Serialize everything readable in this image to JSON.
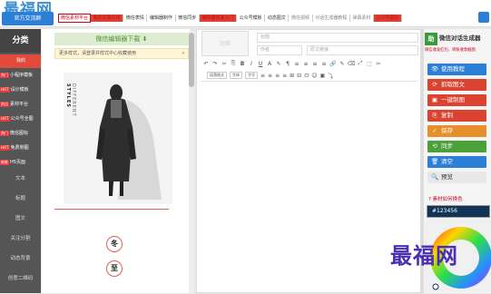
{
  "topbar": {
    "logo_text": "最福网",
    "logo_url": "WWW.ZUIFU.COM",
    "qq_button": "官方交流群",
    "nav": [
      {
        "label": "微信素材平台",
        "style": "redbox"
      },
      {
        "label": "我的文章在线",
        "style": "red"
      },
      {
        "label": "微信表情",
        "style": "normal"
      },
      {
        "label": "编辑器制作",
        "style": "normal"
      },
      {
        "label": "微信同步",
        "style": "normal"
      },
      {
        "label": "编辑器快速入门",
        "style": "red"
      },
      {
        "label": "公众号模板",
        "style": "normal"
      },
      {
        "label": "动态图文",
        "style": "normal"
      },
      {
        "label": "微信视频",
        "style": "gray"
      },
      {
        "label": "对话生成器教程",
        "style": "gray"
      },
      {
        "label": "弹幕素材",
        "style": "gray"
      },
      {
        "label": "公众号图标",
        "style": "red"
      }
    ]
  },
  "categories": {
    "header": "分类",
    "items": [
      {
        "label": "我的",
        "badge": "",
        "active": true
      },
      {
        "label": "小程序模板",
        "badge": "热门",
        "active": false
      },
      {
        "label": "设计模板",
        "badge": "HOT",
        "active": false
      },
      {
        "label": "素材平台",
        "badge": "热点",
        "active": false
      },
      {
        "label": "公众号全图",
        "badge": "HOT",
        "active": false
      },
      {
        "label": "微信图标",
        "badge": "热门",
        "active": false
      },
      {
        "label": "免费侧图",
        "badge": "HOT",
        "active": false
      },
      {
        "label": "H5页面",
        "badge": "新推",
        "active": false
      }
    ],
    "big_items": [
      "文本",
      "标题",
      "图文",
      "关注分割",
      "动态背景",
      "创意二维码"
    ]
  },
  "material": {
    "download_bar": "微信编辑器下载",
    "more_text": "更多样式，请登录并样式中心收藏使用",
    "more_link": "",
    "photo_title_1": "DIFFERENT",
    "photo_title_2": "STYLES",
    "circle_1": "冬",
    "circle_2": "至"
  },
  "editor": {
    "cover_text": "封面",
    "title_placeholder": "标题",
    "author_placeholder": "作者",
    "digest_placeholder": "原文链接",
    "toolbar_icons": [
      "↶",
      "↷",
      "✂",
      "⎘",
      "B",
      "I",
      "U",
      "A",
      "✎",
      "¶",
      "≡",
      "≡",
      "≡",
      "≡",
      "🔗",
      "✎",
      "⌫",
      "⤢",
      "⬚",
      "✂"
    ],
    "toolbar2": {
      "format": "段落格式",
      "font": "字体",
      "size": "字号"
    },
    "toolbar2_icons": [
      "≡",
      "≡",
      "≡",
      "≡",
      "⊞",
      "⊟",
      "⊡",
      "☺",
      "▣",
      "⤵"
    ]
  },
  "right": {
    "brand": "助",
    "title": "微信对话生成器",
    "subtitle": "微信收发红包，转账收款截图",
    "buttons": [
      {
        "icon": "👁",
        "label": "使用教程",
        "color": "blue"
      },
      {
        "icon": "⟳",
        "label": "抓取图文",
        "color": "red"
      },
      {
        "icon": "▣",
        "label": "一键制图",
        "color": "red"
      },
      {
        "icon": "⎘",
        "label": "复制",
        "color": "red"
      },
      {
        "icon": "✓",
        "label": "保存",
        "color": "orange"
      },
      {
        "icon": "⟲",
        "label": "同步",
        "color": "green"
      },
      {
        "icon": "🗑",
        "label": "清空",
        "color": "blue"
      },
      {
        "icon": "🔍",
        "label": "预览",
        "color": "lgray"
      }
    ],
    "bg_color_label": "素材如何换色",
    "hex_value": "#123456"
  },
  "watermark": "最福网"
}
